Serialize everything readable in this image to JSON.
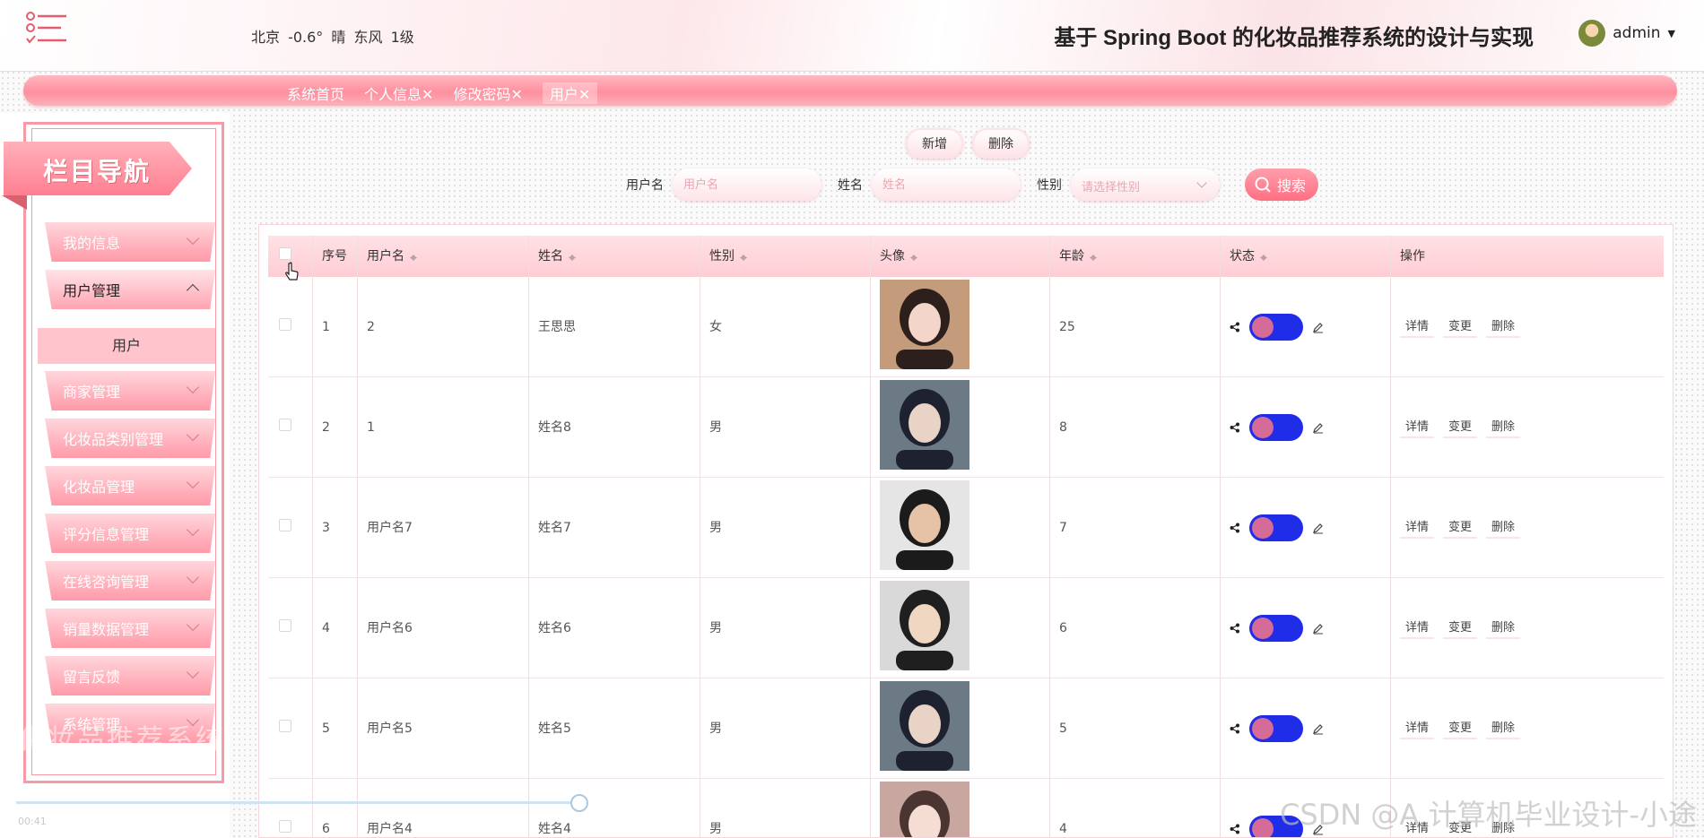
{
  "header": {
    "weather": "北京  -0.6°  晴  东风  1级",
    "title": "基于 Spring Boot 的化妆品推荐系统的设计与实现",
    "user": "admin"
  },
  "tabs": [
    {
      "label": "系统首页",
      "active": false
    },
    {
      "label": "个人信息✕",
      "active": false
    },
    {
      "label": "修改密码✕",
      "active": false
    },
    {
      "label": "用户✕",
      "active": true
    }
  ],
  "sidebar": {
    "title": "栏目导航",
    "items": [
      {
        "label": "我的信息",
        "open": false
      },
      {
        "label": "用户管理",
        "open": true
      },
      {
        "label": "商家管理",
        "open": false
      },
      {
        "label": "化妆品类别管理",
        "open": false
      },
      {
        "label": "化妆品管理",
        "open": false
      },
      {
        "label": "评分信息管理",
        "open": false
      },
      {
        "label": "在线咨询管理",
        "open": false
      },
      {
        "label": "销量数据管理",
        "open": false
      },
      {
        "label": "留言反馈",
        "open": false
      },
      {
        "label": "系统管理",
        "open": false
      }
    ],
    "sub_item": "用户"
  },
  "toolbar": {
    "add": "新增",
    "delete": "删除"
  },
  "search": {
    "username_label": "用户名",
    "username_placeholder": "用户名",
    "name_label": "姓名",
    "name_placeholder": "姓名",
    "gender_label": "性别",
    "gender_placeholder": "请选择性别",
    "button": "搜索"
  },
  "table": {
    "headers": [
      "序号",
      "用户名",
      "姓名",
      "性别",
      "头像",
      "年龄",
      "状态",
      "操作"
    ],
    "ops": [
      "详情",
      "变更",
      "删除"
    ],
    "rows": [
      {
        "idx": "1",
        "username": "2",
        "name": "王思思",
        "gender": "女",
        "age": "25"
      },
      {
        "idx": "2",
        "username": "1",
        "name": "姓名8",
        "gender": "男",
        "age": "8"
      },
      {
        "idx": "3",
        "username": "用户名7",
        "name": "姓名7",
        "gender": "男",
        "age": "7"
      },
      {
        "idx": "4",
        "username": "用户名6",
        "name": "姓名6",
        "gender": "男",
        "age": "6"
      },
      {
        "idx": "5",
        "username": "用户名5",
        "name": "姓名5",
        "gender": "男",
        "age": "5"
      },
      {
        "idx": "6",
        "username": "用户名4",
        "name": "姓名4",
        "gender": "男",
        "age": "4"
      }
    ]
  },
  "overlay": {
    "watermark": "化妆品推荐系统",
    "video_time": "00:41",
    "csdn": "CSDN @A 计算机毕业设计-小途"
  },
  "colors": {
    "accent": "#ff8f9e",
    "toggle_track": "#1f2ce8",
    "toggle_knob": "#d56b98"
  }
}
